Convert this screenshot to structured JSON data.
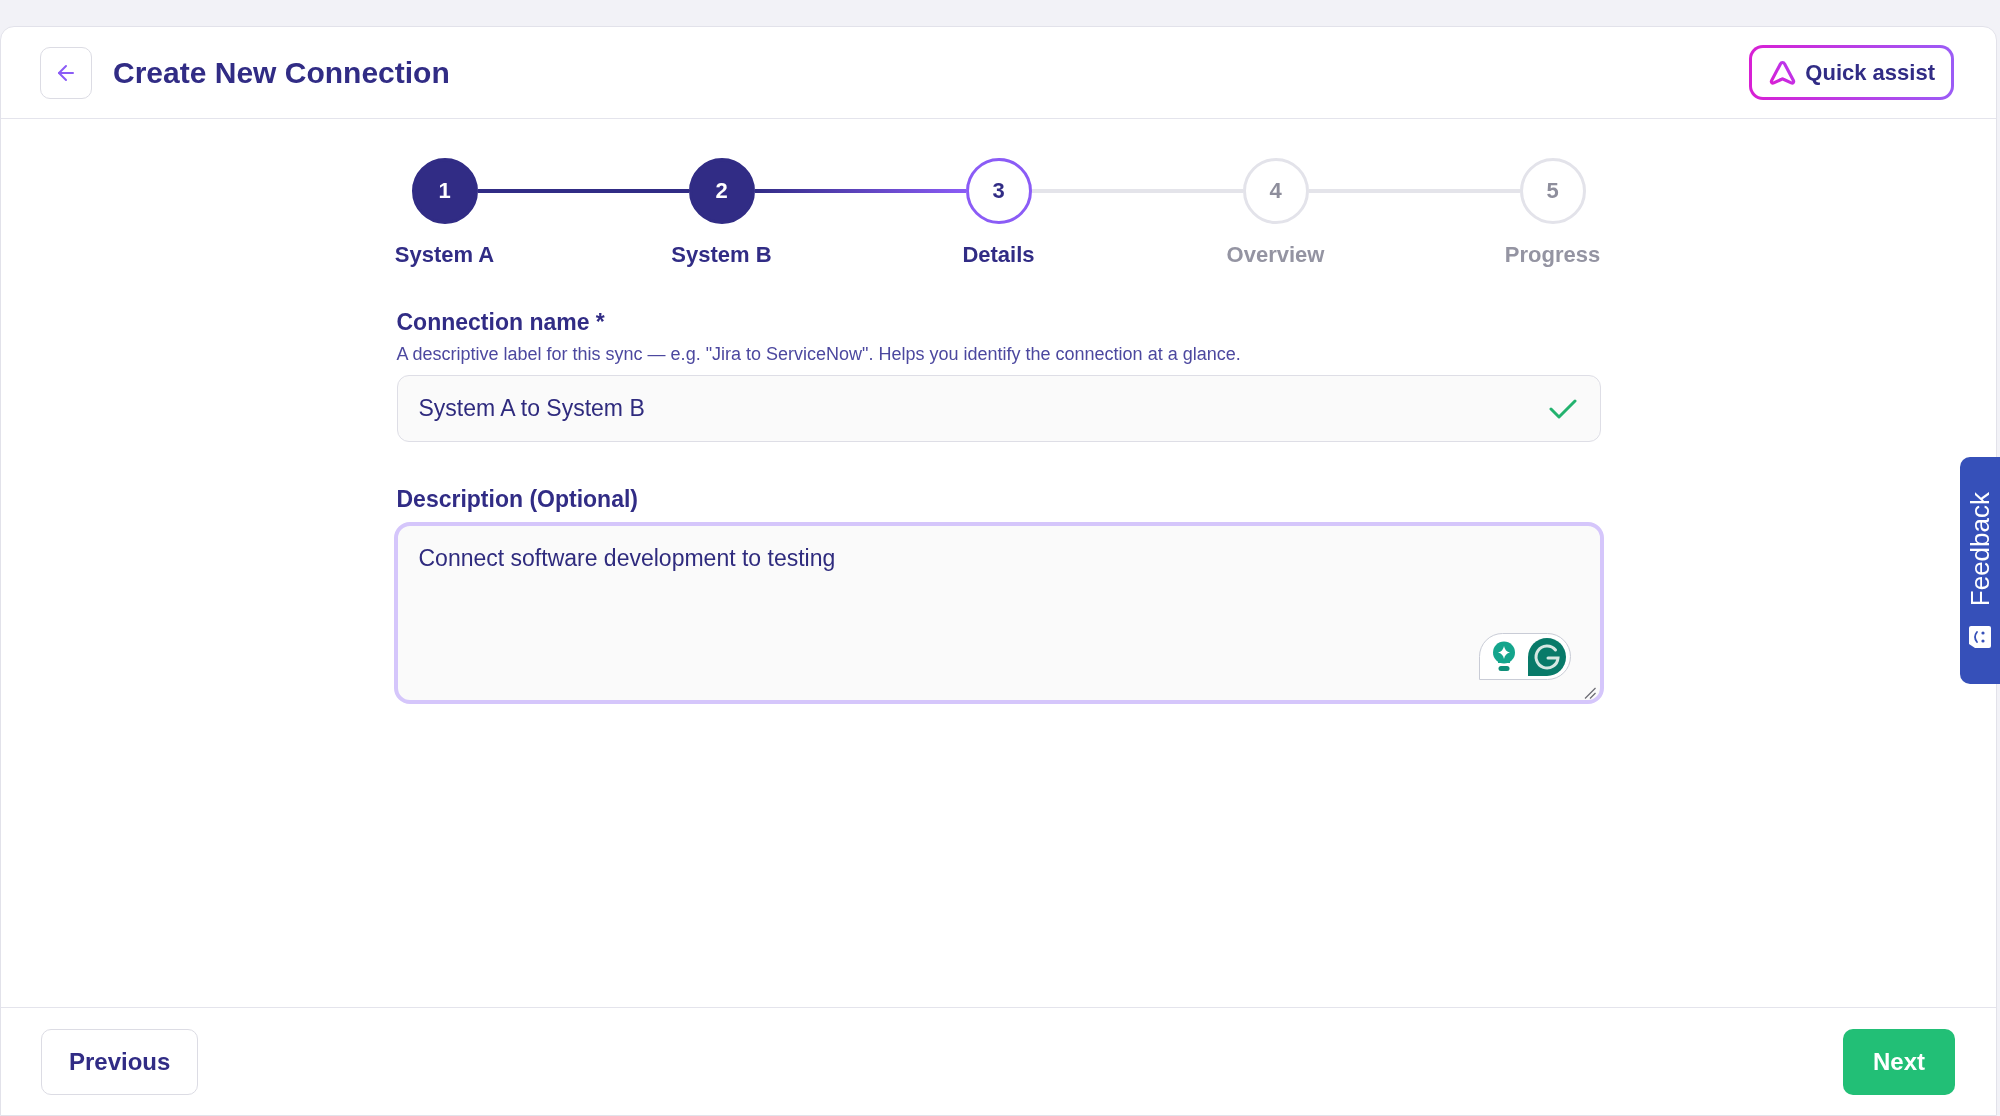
{
  "header": {
    "title": "Create New Connection",
    "assist_button": "Quick assist"
  },
  "steps": [
    {
      "number": "1",
      "label": "System A",
      "completed": true,
      "selected": false
    },
    {
      "number": "2",
      "label": "System B",
      "completed": true,
      "selected": false
    },
    {
      "number": "3",
      "label": "Details",
      "completed": false,
      "selected": true
    },
    {
      "number": "4",
      "label": "Overview",
      "completed": false,
      "selected": false
    },
    {
      "number": "5",
      "label": "Progress",
      "completed": false,
      "selected": false
    }
  ],
  "connection_name": {
    "label": "Connection name *",
    "hint": "A descriptive label for this sync — e.g. \"Jira to ServiceNow\". Helps you identify the connection at a glance.",
    "value": "System A to System B",
    "valid": true
  },
  "description": {
    "label": "Description (Optional)",
    "value": "Connect software development to testing",
    "focused": true
  },
  "feedback_tab": {
    "label": "Feedback"
  },
  "footer": {
    "previous": "Previous",
    "next": "Next"
  }
}
